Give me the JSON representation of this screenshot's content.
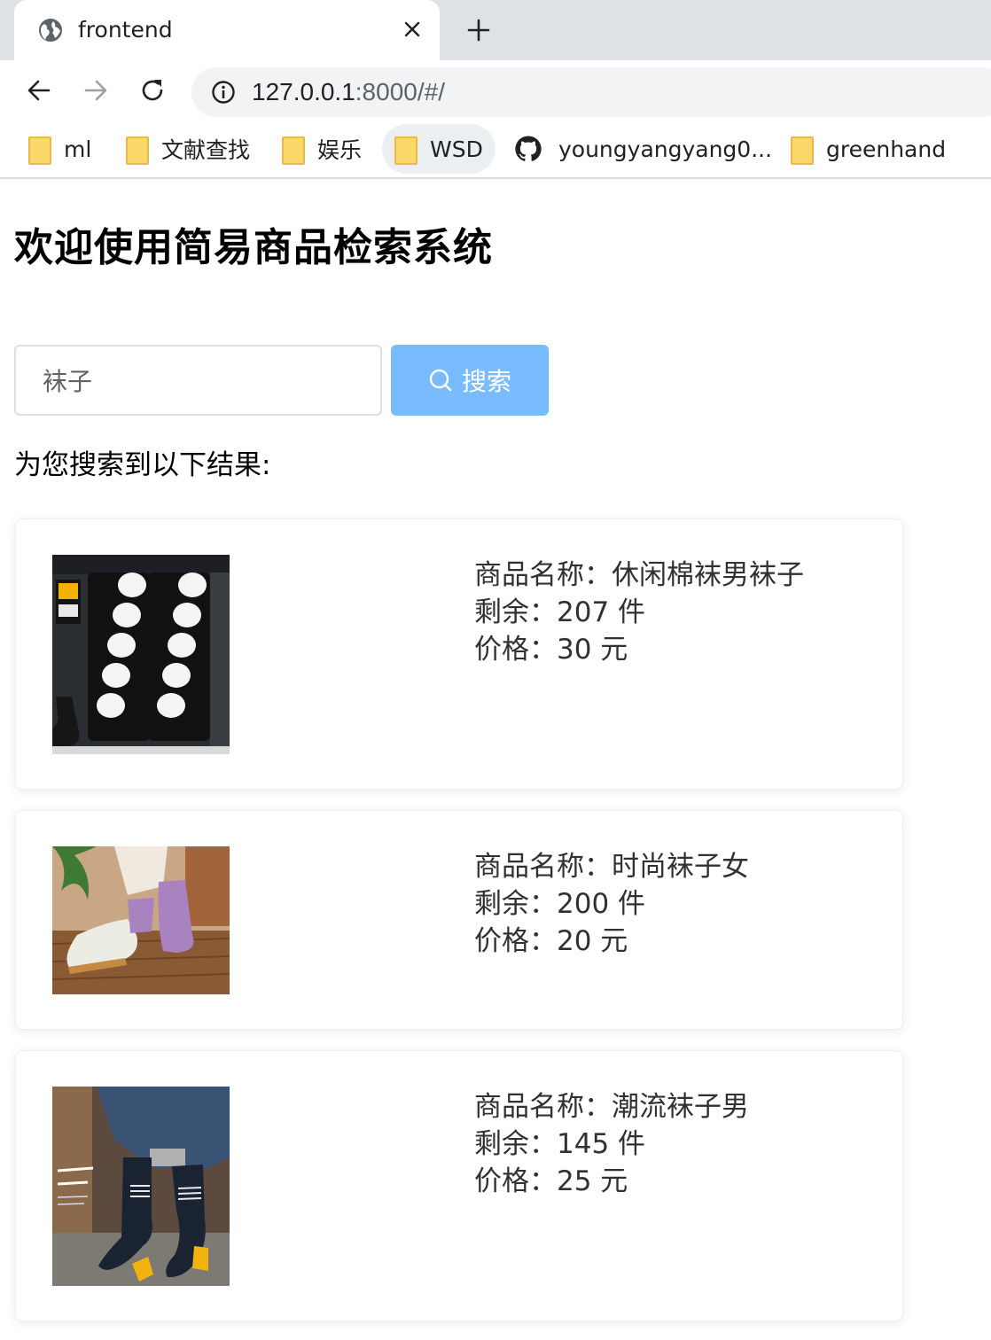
{
  "browser": {
    "tab_title": "frontend",
    "url_host": "127.0.0.1",
    "url_rest": ":8000/#/",
    "bookmarks": [
      {
        "label": "ml",
        "icon": "folder-icon"
      },
      {
        "label": "文献查找",
        "icon": "folder-icon"
      },
      {
        "label": "娱乐",
        "icon": "folder-icon"
      },
      {
        "label": "WSD",
        "icon": "folder-icon"
      },
      {
        "label": "youngyangyang0...",
        "icon": "github-icon"
      },
      {
        "label": "greenhand",
        "icon": "folder-icon"
      }
    ]
  },
  "page": {
    "title": "欢迎使用简易商品检索系统",
    "search": {
      "value": "袜子",
      "button_label": "搜索"
    },
    "result_text": "为您搜索到以下结果:"
  },
  "products": [
    {
      "name_label": "商品名称：休闲棉袜男袜子",
      "stock_label": "剩余：207 件",
      "price_label": "价格：30 元"
    },
    {
      "name_label": "商品名称：时尚袜子女",
      "stock_label": "剩余：200 件",
      "price_label": "价格：20 元"
    },
    {
      "name_label": "商品名称：潮流袜子男",
      "stock_label": "剩余：145 件",
      "price_label": "价格：25 元"
    }
  ],
  "colors": {
    "primary_button": "#79bbff",
    "tab_strip": "#dee1e6",
    "omnibox": "#f1f3f4"
  }
}
